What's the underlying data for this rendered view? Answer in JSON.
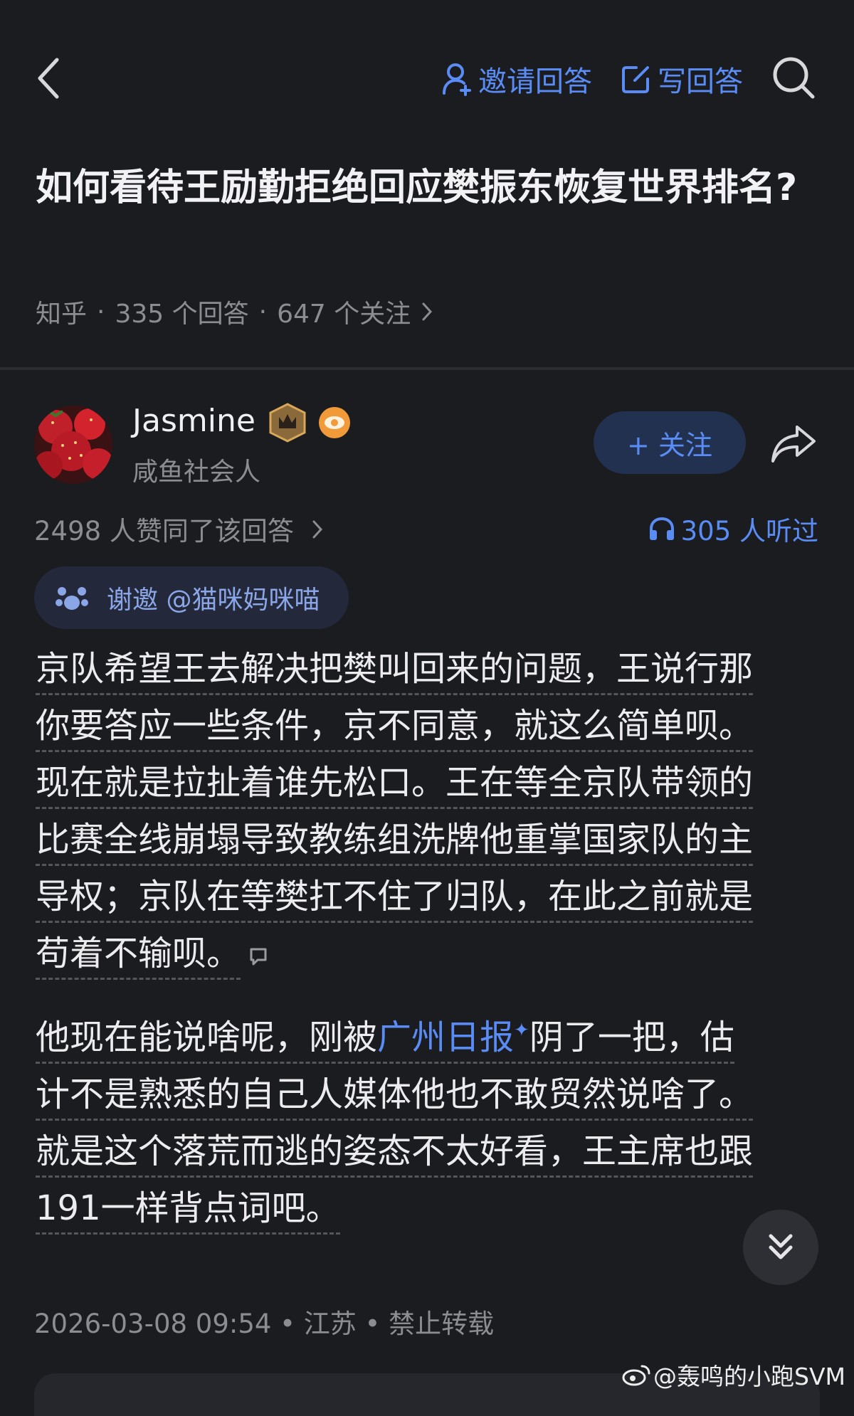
{
  "nav": {
    "invite_label": "邀请回答",
    "write_label": "写回答"
  },
  "question": {
    "title": "如何看待王励勤拒绝回应樊振东恢复世界排名?",
    "source": "知乎",
    "answers": "335 个回答",
    "followers": "647 个关注"
  },
  "author": {
    "name": "Jasmine",
    "bio": "咸鱼社会人",
    "follow_label": "+ 关注"
  },
  "stats": {
    "likes": "2498 人赞同了该回答",
    "listened": "305 人听过"
  },
  "invite": {
    "label": "谢邀 @猫咪妈咪喵"
  },
  "answer": {
    "para1": [
      "京队希望王去解决把樊叫回来的问题，王说行那",
      "你要答应一些条件，京不同意，就这么简单呗。",
      "现在就是拉扯着谁先松口。王在等全京队带领的",
      "比赛全线崩塌导致教练组洗牌他重掌国家队的主",
      "导权；京队在等樊扛不住了归队，在此之前就是",
      "苟着不输呗。"
    ],
    "para2_line1_pre": "他现在能说啥呢，刚被",
    "para2_link": "广州日报",
    "para2_line1_post": "阴了一把，估",
    "para2": [
      "计不是熟悉的自己人媒体他也不敢贸然说啥了。",
      "就是这个落荒而逃的姿态不太好看，王主席也跟",
      "191一样背点词吧。"
    ]
  },
  "footer": {
    "meta": "2026-03-08 09:54 • 江苏 • 禁止转载",
    "watermark": "@轰鸣的小跑SVM"
  },
  "colors": {
    "background": "#1b1c20",
    "accent": "#5a8cf6",
    "muted": "#8c8d92"
  },
  "icons": [
    "back-arrow-icon",
    "person-add-icon",
    "edit-icon",
    "search-icon",
    "crown-badge-icon",
    "eye-badge-icon",
    "share-icon",
    "headphones-icon",
    "cat-icon",
    "comment-icon",
    "double-chevron-down-icon",
    "weibo-icon"
  ]
}
